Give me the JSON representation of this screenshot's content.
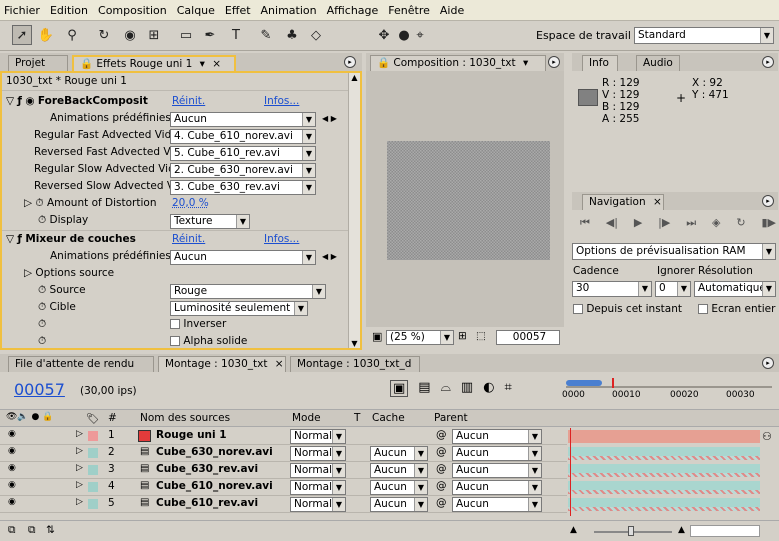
{
  "menu": [
    "Fichier",
    "Edition",
    "Composition",
    "Calque",
    "Effet",
    "Animation",
    "Affichage",
    "Fenêtre",
    "Aide"
  ],
  "workspace": {
    "label": "Espace de travail :",
    "value": "Standard"
  },
  "effects_panel": {
    "tab_project": "Projet",
    "tab_effects": "Effets Rouge uni 1",
    "header": "1030_txt * Rouge uni 1",
    "effect1": {
      "name": "ForeBackComposit",
      "reset": "Réinit.",
      "info": "Infos...",
      "presets_label": "Animations prédéfinies :",
      "presets_value": "Aucun",
      "params": [
        {
          "label": "Regular Fast Advected Vid",
          "value": "4. Cube_610_norev.avi"
        },
        {
          "label": "Reversed Fast Advected Vi",
          "value": "5. Cube_610_rev.avi"
        },
        {
          "label": "Regular Slow Advected Vid",
          "value": "2. Cube_630_norev.avi"
        },
        {
          "label": "Reversed Slow Advected V",
          "value": "3. Cube_630_rev.avi"
        }
      ],
      "distortion_label": "Amount of Distortion",
      "distortion_value": "20,0 %",
      "display_label": "Display",
      "display_value": "Texture"
    },
    "effect2": {
      "name": "Mixeur de couches",
      "reset": "Réinit.",
      "info": "Infos...",
      "presets_label": "Animations prédéfinies :",
      "presets_value": "Aucun",
      "source_options": "Options source",
      "source_label": "Source",
      "source_value": "Rouge",
      "target_label": "Cible",
      "target_value": "Luminosité seulement",
      "invert_label": "Inverser",
      "alpha_label": "Alpha solide"
    }
  },
  "composition": {
    "tab": "Composition : 1030_txt",
    "zoom": "(25 %)",
    "timecode": "00057"
  },
  "info": {
    "tab_info": "Info",
    "tab_audio": "Audio",
    "r": "R : 129",
    "v": "V : 129",
    "b": "B : 129",
    "a": "A : 255",
    "x": "X : 92",
    "y": "Y : 471"
  },
  "navigation": {
    "tab": "Navigation",
    "ram_options": "Options de prévisualisation RAM",
    "cadence_label": "Cadence",
    "skip_label": "Ignorer",
    "resolution_label": "Résolution",
    "cadence_value": "30",
    "skip_value": "0",
    "resolution_value": "Automatique",
    "from_current": "Depuis cet instant",
    "full_screen": "Ecran entier"
  },
  "timeline": {
    "tab_render": "File d'attente de rendu",
    "tab_montage1": "Montage : 1030_txt",
    "tab_montage2": "Montage : 1030_txt_d",
    "timecode": "00057",
    "fps": "(30,00 ips)",
    "ruler": [
      "0000",
      "00010",
      "00020",
      "00030"
    ],
    "columns": {
      "num": "#",
      "source": "Nom des sources",
      "mode": "Mode",
      "t": "T",
      "cache": "Cache",
      "parent": "Parent"
    },
    "layers": [
      {
        "num": "1",
        "name": "Rouge uni 1",
        "mode": "Normal",
        "cache": "",
        "parent": "Aucun",
        "color": "#e06060"
      },
      {
        "num": "2",
        "name": "Cube_630_norev.avi",
        "mode": "Normal",
        "cache": "Aucun",
        "parent": "Aucun",
        "color": "#9fcfc8"
      },
      {
        "num": "3",
        "name": "Cube_630_rev.avi",
        "mode": "Normal",
        "cache": "Aucun",
        "parent": "Aucun",
        "color": "#9fcfc8"
      },
      {
        "num": "4",
        "name": "Cube_610_norev.avi",
        "mode": "Normal",
        "cache": "Aucun",
        "parent": "Aucun",
        "color": "#9fcfc8"
      },
      {
        "num": "5",
        "name": "Cube_610_rev.avi",
        "mode": "Normal",
        "cache": "Aucun",
        "parent": "Aucun",
        "color": "#9fcfc8"
      }
    ]
  },
  "colors": {
    "accent_blue": "#1c4fd0",
    "red_layer": "#e33b3b",
    "teal_bar": "#a9d6cf",
    "salmon_bar": "#e6a093",
    "panel_highlight": "#f0c040"
  }
}
